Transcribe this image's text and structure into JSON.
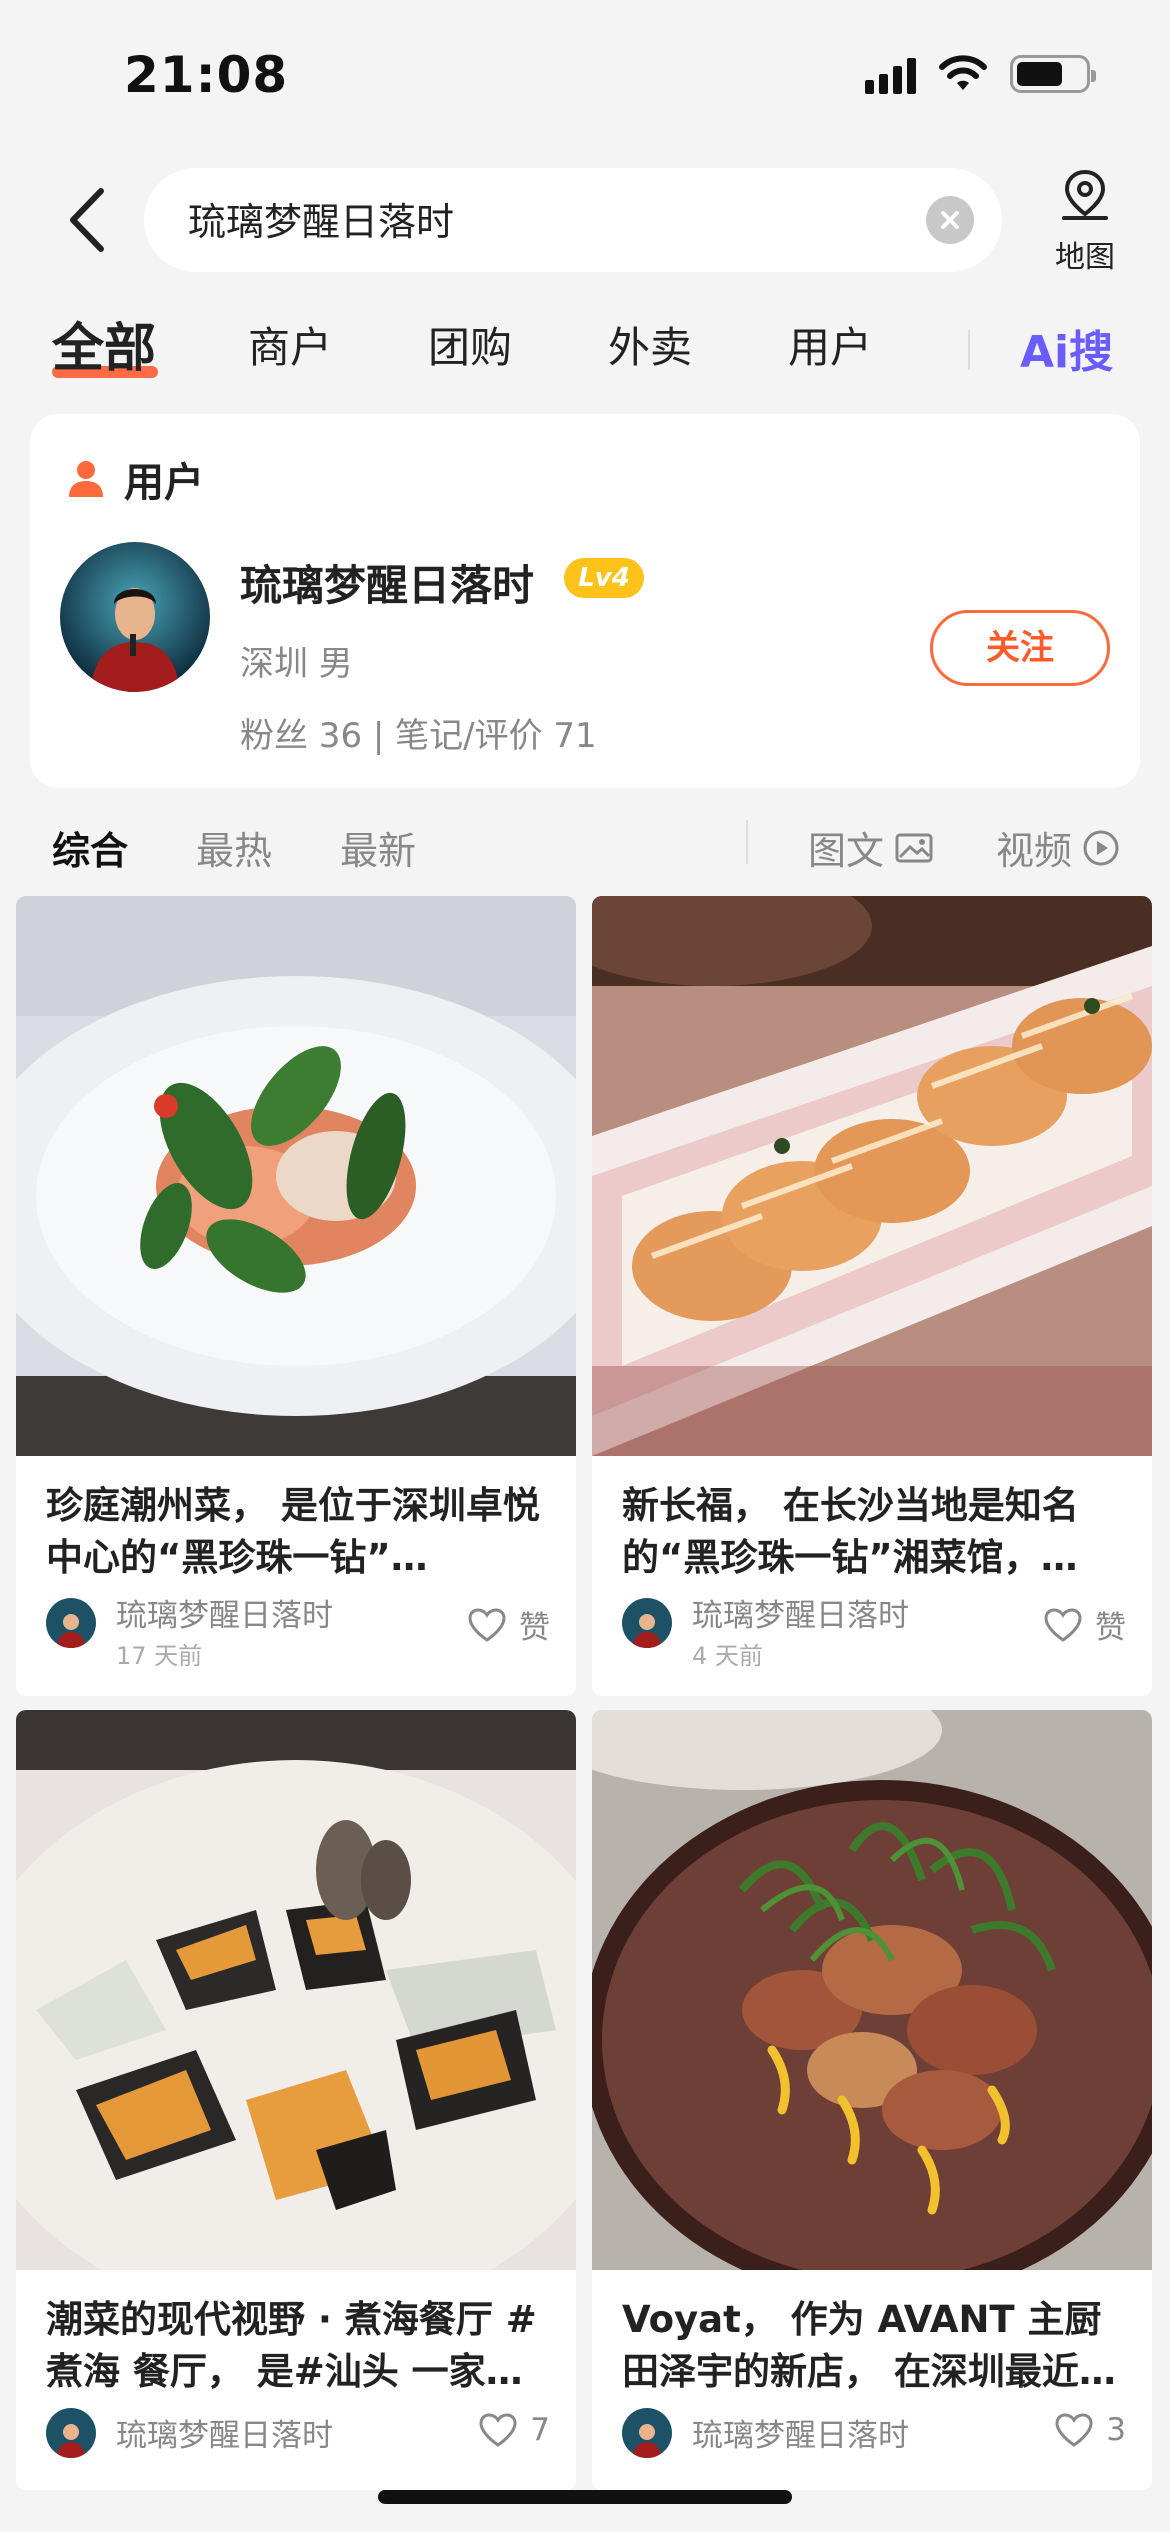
{
  "status_bar": {
    "time": "21:08",
    "battery_level": 0.68
  },
  "search": {
    "query": "琉璃梦醒日落时",
    "map_label": "地图"
  },
  "tabs": {
    "items": [
      "全部",
      "商户",
      "团购",
      "外卖",
      "用户"
    ],
    "active": "全部",
    "ai_search": "Ai搜"
  },
  "user_section": {
    "header": "用户",
    "name": "琉璃梦醒日落时",
    "level": "Lv4",
    "city_gender": "深圳  男",
    "stats": "粉丝  36  |  笔记/评价  71",
    "follow_label": "关注"
  },
  "sort": {
    "items": [
      "综合",
      "最热",
      "最新"
    ],
    "active": "综合",
    "type_image_text": "图文",
    "type_video": "视频"
  },
  "feed": [
    {
      "title": "珍庭潮州菜， 是位于深圳卓悦中心的“黑珍珠一钻”…",
      "author": "琉璃梦醒日落时",
      "time": "17 天前",
      "likes": "赞"
    },
    {
      "title": "新长福， 在长沙当地是知名的“黑珍珠一钻”湘菜馆，…",
      "author": "琉璃梦醒日落时",
      "time": "4 天前",
      "likes": "赞"
    },
    {
      "title": "潮菜的现代视野 · 煮海餐厅 #煮海 餐厅， 是#汕头 一家…",
      "author": "琉璃梦醒日落时",
      "time": "",
      "likes": "7"
    },
    {
      "title": "Voyat， 作为 AVANT 主厨田泽宇的新店， 在深圳最近…",
      "author": "琉璃梦醒日落时",
      "time": "",
      "likes": "3"
    }
  ]
}
